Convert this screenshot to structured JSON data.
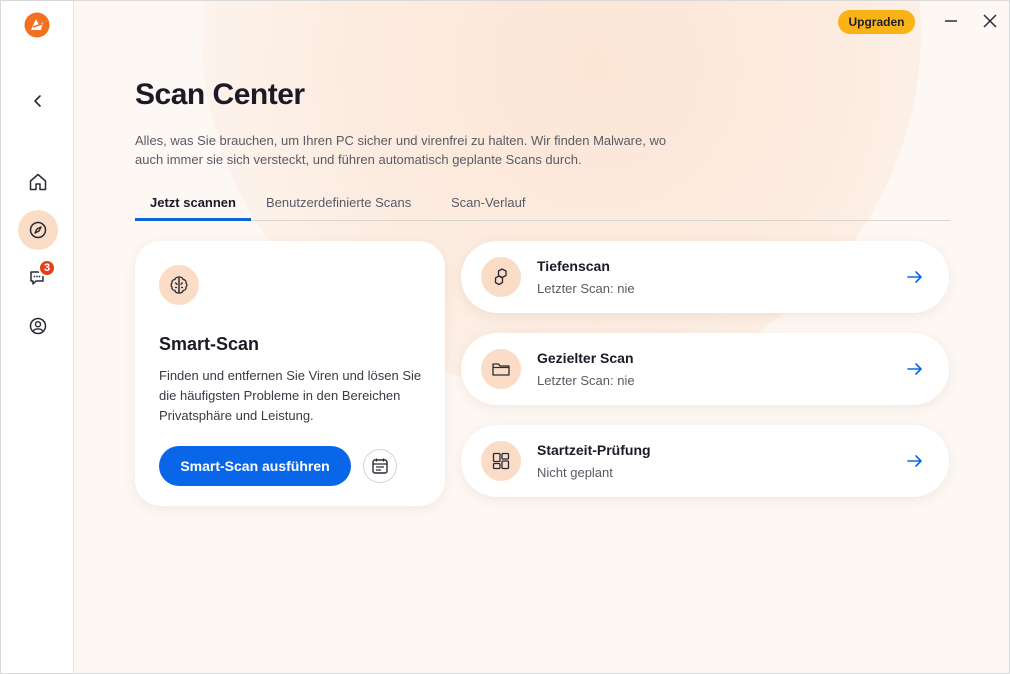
{
  "window": {
    "upgrade_label": "Upgraden"
  },
  "sidebar": {
    "items": [
      {
        "icon": "back-arrow-icon"
      },
      {
        "icon": "home-icon"
      },
      {
        "icon": "compass-icon",
        "active": true
      },
      {
        "icon": "chat-icon",
        "badge": "3"
      },
      {
        "icon": "account-icon"
      }
    ]
  },
  "page": {
    "title": "Scan Center",
    "subtitle": "Alles, was Sie brauchen, um Ihren PC sicher und virenfrei zu halten. Wir finden Malware, wo auch immer sie sich versteckt, und führen automatisch geplante Scans durch."
  },
  "tabs": [
    {
      "label": "Jetzt scannen",
      "active": true
    },
    {
      "label": "Benutzerdefinierte Scans",
      "active": false
    },
    {
      "label": "Scan-Verlauf",
      "active": false
    }
  ],
  "smart_scan": {
    "icon": "brain-icon",
    "title": "Smart-Scan",
    "description": "Finden und entfernen Sie Viren und lösen Sie die häufigsten Probleme in den Bereichen Privatsphäre und Leistung.",
    "run_label": "Smart-Scan ausführen",
    "schedule_icon": "calendar-icon"
  },
  "scans": [
    {
      "icon": "hexagons-icon",
      "title": "Tiefenscan",
      "subtitle": "Letzter Scan: nie"
    },
    {
      "icon": "folder-icon",
      "title": "Gezielter Scan",
      "subtitle": "Letzter Scan: nie"
    },
    {
      "icon": "windows-tiles-icon",
      "title": "Startzeit-Prüfung",
      "subtitle": "Nicht geplant"
    }
  ],
  "colors": {
    "accent_blue": "#0a66e8",
    "brand_orange": "#f37021",
    "upgrade_yellow": "#f9b317",
    "icon_bg": "#fbdcc7",
    "badge_red": "#e2401c"
  }
}
